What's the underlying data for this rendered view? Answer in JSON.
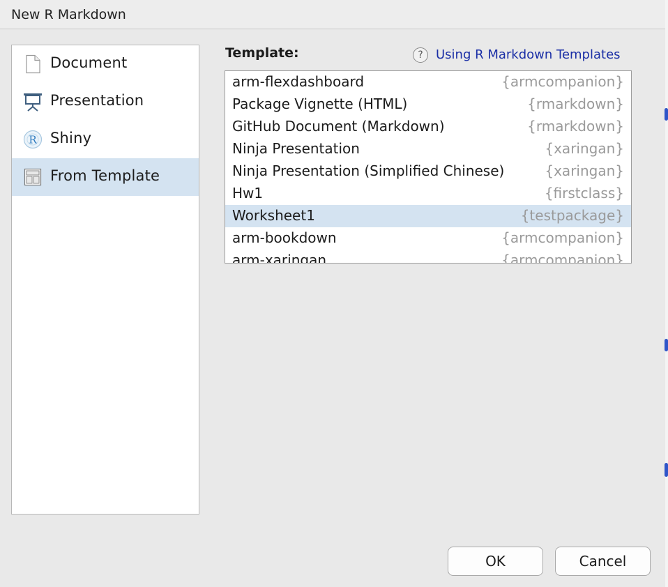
{
  "dialog": {
    "title": "New R Markdown"
  },
  "sidebar": {
    "items": [
      {
        "label": "Document",
        "icon": "document-icon",
        "selected": false
      },
      {
        "label": "Presentation",
        "icon": "presentation-icon",
        "selected": false
      },
      {
        "label": "Shiny",
        "icon": "shiny-icon",
        "selected": false
      },
      {
        "label": "From Template",
        "icon": "template-icon",
        "selected": true
      }
    ]
  },
  "main": {
    "template_label": "Template:",
    "help_icon_glyph": "?",
    "help_link": "Using R Markdown Templates",
    "templates": [
      {
        "name": "arm-flexdashboard",
        "package": "{armcompanion}",
        "selected": false
      },
      {
        "name": "Package Vignette (HTML)",
        "package": "{rmarkdown}",
        "selected": false
      },
      {
        "name": "GitHub Document (Markdown)",
        "package": "{rmarkdown}",
        "selected": false
      },
      {
        "name": "Ninja Presentation",
        "package": "{xaringan}",
        "selected": false
      },
      {
        "name": "Ninja Presentation (Simplified Chinese)",
        "package": "{xaringan}",
        "selected": false
      },
      {
        "name": "Hw1",
        "package": "{firstclass}",
        "selected": false
      },
      {
        "name": "Worksheet1",
        "package": "{testpackage}",
        "selected": true
      },
      {
        "name": "arm-bookdown",
        "package": "{armcompanion}",
        "selected": false
      },
      {
        "name": "arm-xaringan",
        "package": "{armcompanion}",
        "selected": false
      }
    ]
  },
  "buttons": {
    "ok": "OK",
    "cancel": "Cancel"
  },
  "colors": {
    "selection": "#d4e3f1",
    "link": "#1b2fa6",
    "package_text": "#9a9a9a"
  }
}
